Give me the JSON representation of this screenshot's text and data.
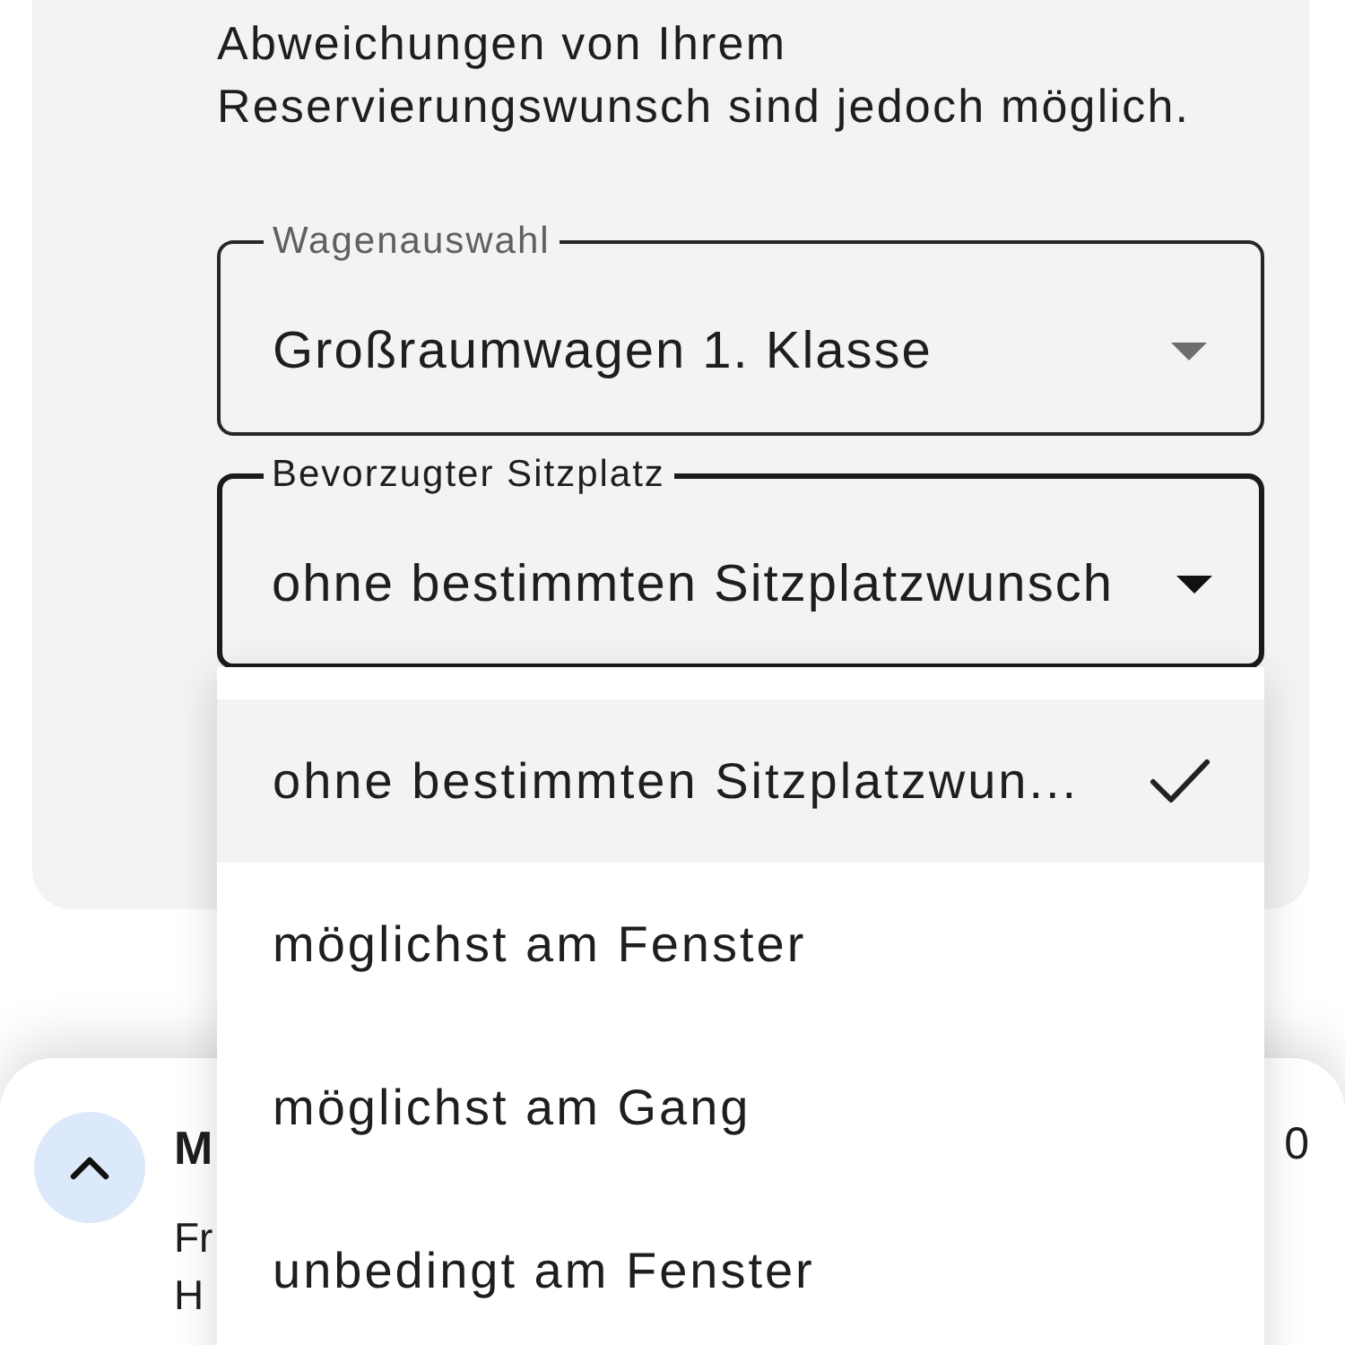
{
  "intro": {
    "lines": [
      "Abweichungen von Ihrem",
      "Reservierungswunsch sind jedoch möglich."
    ]
  },
  "selects": [
    {
      "label": "Wagenauswahl",
      "value": "Großraumwagen 1. Klasse",
      "focused": false
    },
    {
      "label": "Bevorzugter Sitzplatz",
      "value": "ohne bestimmten Sitzplatzwunsch",
      "focused": true
    }
  ],
  "dropdown": {
    "options": [
      {
        "label": "ohne bestimmten Sitzplatzwun...",
        "selected": true
      },
      {
        "label": "möglichst am Fenster",
        "selected": false
      },
      {
        "label": "möglichst am Gang",
        "selected": false
      },
      {
        "label": "unbedingt am Fenster",
        "selected": false
      }
    ]
  },
  "bottom_sheet": {
    "title": "M",
    "lines": [
      "Fr",
      "H"
    ],
    "value": "0"
  }
}
